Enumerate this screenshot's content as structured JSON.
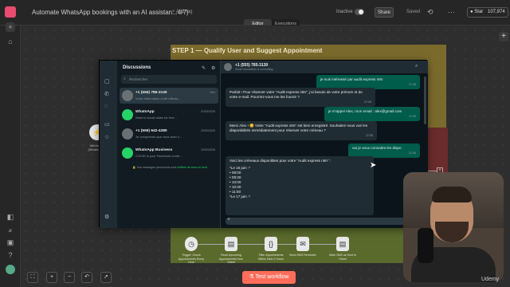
{
  "app": {
    "workflow_title": "Automate WhatsApp bookings with an AI assistan...4/7)",
    "add_tag": "+ Add tag",
    "tabs": [
      "Editor",
      "Executions"
    ],
    "inactive_label": "Inactive",
    "share_label": "Share",
    "saved_label": "Saved",
    "star_label": "Star",
    "star_count": "107,974",
    "test_workflow_label": "Test workflow",
    "watermark": "Udemy"
  },
  "canvas": {
    "step_title": "STEP 1 — Qualify User and Suggest Appointment",
    "left_node_label": "Webhook (WhatsApp)",
    "bottom_nodes": [
      {
        "label": "Trigger: Check Appointments Every Hour",
        "icon": "clock-icon"
      },
      {
        "label": "Read Upcoming Appointments from Sheet",
        "icon": "sheet-icon"
      },
      {
        "label": "Filter Appointments Within Next 2 Hours",
        "icon": "code-icon"
      },
      {
        "label": "Send SMS Reminder",
        "icon": "message-icon"
      },
      {
        "label": "Mark SMS as Sent in Sheet",
        "icon": "sheet-icon"
      }
    ]
  },
  "whatsapp": {
    "discussions_title": "Discussions",
    "search_placeholder": "Rechercher",
    "chats": [
      {
        "name": "+1 (555) 785-3130",
        "preview": "Votre réservation a été effectu...",
        "date": "Hier"
      },
      {
        "name": "WhatsApp",
        "preview": "Want to boost sales for free...",
        "date": "01/03/2025"
      },
      {
        "name": "+1 (555) 642-4280",
        "preview": "Je comprends que vous avez v...",
        "date": "20/02/2025"
      },
      {
        "name": "WhatsApp Business",
        "preview": "COVID is your Facebook confir...",
        "date": "20/02/2025"
      }
    ],
    "encryption_note_prefix": "Vos messages personnels sont ",
    "encryption_note_link": "chiffrés de bout en bout",
    "header_name": "+1 (555) 785-3130",
    "header_sub": "Smart innovation & consulting",
    "messages": [
      {
        "dir": "out",
        "text": "je suis intéressé par audit express n8n",
        "time": "17:28"
      },
      {
        "dir": "in",
        "text": "Parfait ! Pour réserver votre \"Audit express n8n\", j'ai besoin de votre prénom et de votre e-mail. Pourriez-vous me les fournir ?",
        "time": "17:29"
      },
      {
        "dir": "out",
        "text": "je m'appel Alex, mon email : alex@gmail.com",
        "time": "17:29"
      },
      {
        "dir": "in",
        "text": "Merci Alex ! 😊 Votre \"Audit express n8n\" est bien enregistré. Souhaitez-vous voir les disponibilités immédiatement pour réserver votre créneau ?",
        "time": "17:30"
      },
      {
        "dir": "out",
        "text": "oui je veux connaitre les dispo",
        "time": "17:30"
      },
      {
        "dir": "in",
        "text": "Voici les créneaux disponibles pour votre \"Audit express n8n\" :",
        "time": ""
      }
    ],
    "slots_day": "*Le 16 juin :*",
    "slots": [
      "09:00",
      "09:30",
      "10:00",
      "10:30",
      "11:00"
    ],
    "slots_next": "*Le 17 juin :*"
  }
}
